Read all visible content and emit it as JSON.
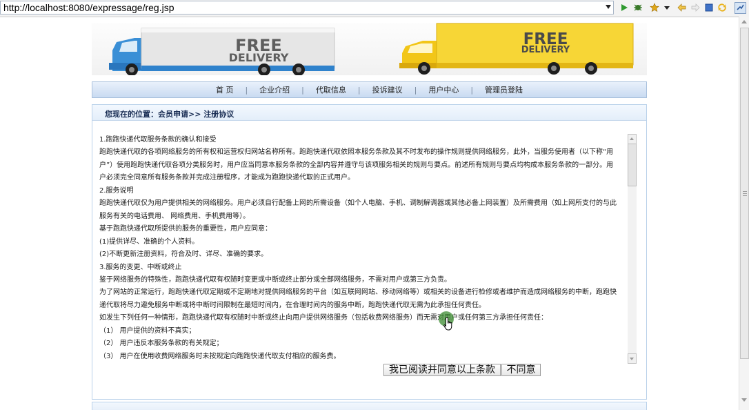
{
  "browser": {
    "url": "http://localhost:8080/expressage/reg.jsp",
    "icons": [
      "run-icon",
      "debug-icon",
      "star-icon",
      "dropdown-icon",
      "back-icon",
      "forward-icon",
      "stop-icon",
      "refresh-icon",
      "sync-icon"
    ]
  },
  "banner": {
    "left_truck_text": "FREE DELIVERY",
    "right_truck_text": "FREE DELIVERY",
    "colors": {
      "left_truck": "#3a8fd6",
      "right_truck": "#f2c618"
    }
  },
  "nav": {
    "items": [
      "首 页",
      "企业介绍",
      "代取信息",
      "投诉建议",
      "用户中心",
      "管理员登陆"
    ],
    "separator": "|"
  },
  "breadcrumb": "您现在的位置：会员申请>> 注册协议",
  "terms": {
    "lines": [
      "1.跑跑快递代取服务条款的确认和接受",
      "跑跑快递代取的各项网络服务的所有权和运营权归网站名称所有。跑跑快递代取依照本服务条款及其不时发布的操作规则提供网络服务，此外，当服务使用者（以下称“用",
      "户”）使用跑跑快递代取各项分类服务时，用户应当同意本服务条款的全部内容并遵守与该项服务相关的规则与要点。前述所有规则与要点均构成本服务条款的一部分。用",
      "户必须完全同意所有服务条款并完成注册程序，才能成为跑跑快递代取的正式用户。",
      "2.服务说明",
      "跑跑快递代取仅为用户提供相关的网络服务。用户必须自行配备上网的所需设备（如个人电脑、手机、调制解调器或其他必备上网装置）及所需费用（如上网所支付的与此",
      "服务有关的电话费用、 网络费用、手机费用等）。",
      "基于跑跑快递代取所提供的服务的重要性，用户应同意：",
      "(1)提供详尽、准确的个人资料。",
      "(2)不断更新注册资料，符合及时、详尽、准确的要求。",
      "3.服务的变更、中断或终止",
      "鉴于网络服务的特殊性，跑跑快递代取有权随时变更或中断或终止部分或全部网络服务，不需对用户或第三方负责。",
      "为了网站的正常运行，跑跑快递代取定期或不定期地对提供网络服务的平台（如互联网网站、移动网络等）或相关的设备进行检修或者维护而造成网络服务的中断，跑跑快",
      "递代取将尽力避免服务中断或将中断时间限制在最短时间内，在合理时间内的服务中断，跑跑快递代取无需为此承担任何责任。",
      "如发生下列任何一种情形，跑跑快递代取有权随时中断或终止向用户提供网络服务（包括收费网络服务）而无需对用户或任何第三方承担任何责任：",
      "（1） 用户提供的资料不真实；",
      "（2） 用户违反本服务条款的有关规定；",
      "（3） 用户在使用收费网络服务时未按规定向跑跑快递代取支付相应的服务费。"
    ]
  },
  "buttons": {
    "agree": "我已阅读并同意以上条款",
    "disagree": "不同意"
  }
}
